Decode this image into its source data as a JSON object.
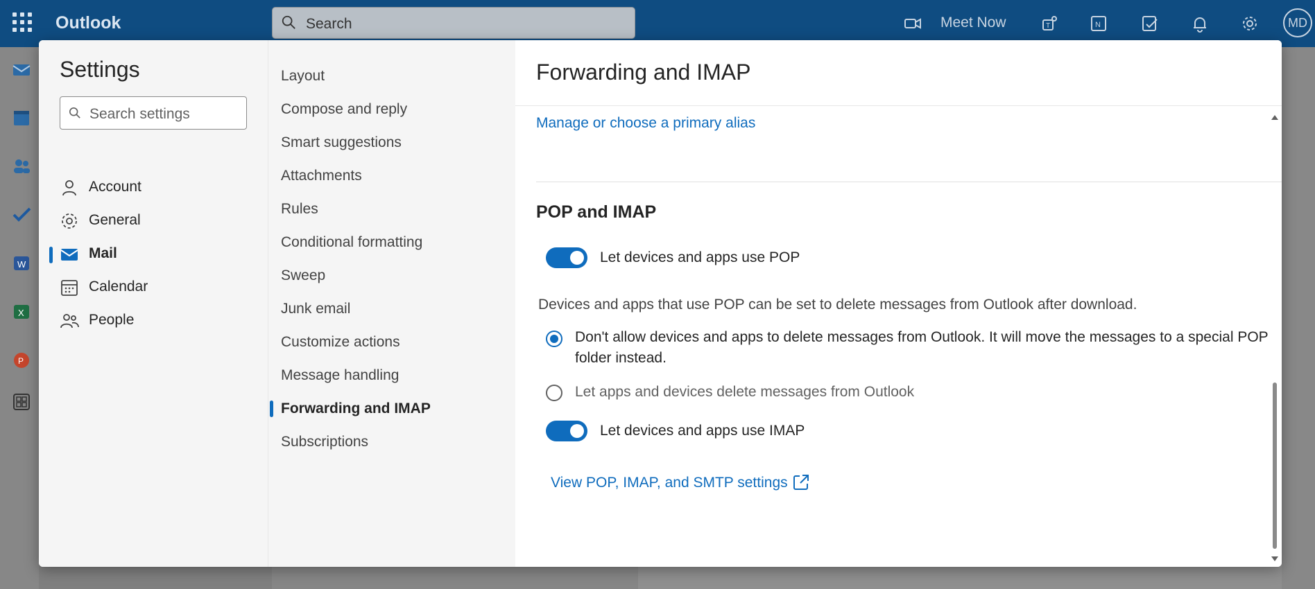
{
  "topbar": {
    "brand": "Outlook",
    "search_placeholder": "Search",
    "meet_now": "Meet Now",
    "avatar_initials": "MD"
  },
  "settings": {
    "title": "Settings",
    "search_placeholder": "Search settings",
    "categories": [
      {
        "label": "Account",
        "icon": "person-icon"
      },
      {
        "label": "General",
        "icon": "gear-icon"
      },
      {
        "label": "Mail",
        "icon": "mail-icon",
        "active": true
      },
      {
        "label": "Calendar",
        "icon": "calendar-icon"
      },
      {
        "label": "People",
        "icon": "people-icon"
      }
    ],
    "mail_items": [
      "Layout",
      "Compose and reply",
      "Smart suggestions",
      "Attachments",
      "Rules",
      "Conditional formatting",
      "Sweep",
      "Junk email",
      "Customize actions",
      "Message handling",
      "Forwarding and IMAP",
      "Subscriptions"
    ],
    "active_mail_item": "Forwarding and IMAP"
  },
  "panel": {
    "title": "Forwarding and IMAP",
    "alias_link": "Manage or choose a primary alias",
    "section_title": "POP and IMAP",
    "pop_toggle_label": "Let devices and apps use POP",
    "pop_toggle_on": true,
    "pop_description": "Devices and apps that use POP can be set to delete messages from Outlook after download.",
    "radio_options": [
      {
        "label": "Don't allow devices and apps to delete messages from Outlook. It will move the messages to a special POP folder instead.",
        "selected": true
      },
      {
        "label": "Let apps and devices delete messages from Outlook",
        "selected": false
      }
    ],
    "imap_toggle_label": "Let devices and apps use IMAP",
    "imap_toggle_on": true,
    "smtp_link": "View POP, IMAP, and SMTP settings"
  },
  "colors": {
    "accent": "#0f6cbd",
    "topbar": "#0f4c81"
  }
}
